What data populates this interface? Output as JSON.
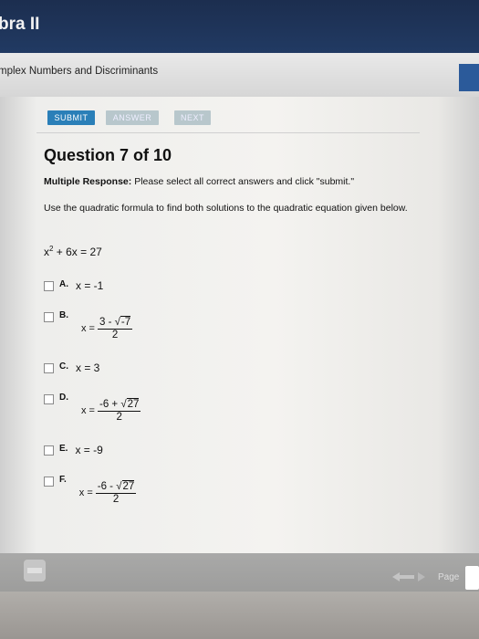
{
  "header": {
    "course_title": "bra II",
    "lesson_title": "mplex Numbers and Discriminants"
  },
  "toolbar": {
    "submit_label": "SUBMIT",
    "answer_label": "ANSWER",
    "next_label": "NEXT"
  },
  "question": {
    "title": "Question 7 of 10",
    "response_type": "Multiple Response:",
    "response_instruction": "Please select all correct answers and click \"submit.\"",
    "instruction": "Use the quadratic formula to find both solutions to the quadratic equation given below.",
    "equation": {
      "base": "x",
      "exponent": "2",
      "rest": " + 6x = 27"
    }
  },
  "options": [
    {
      "letter": "A.",
      "text": "x = -1"
    },
    {
      "letter": "B.",
      "x_eq": "x =",
      "numerator_prefix": "3 - ",
      "root_symbol": "√",
      "radicand": "-7",
      "denominator": "2"
    },
    {
      "letter": "C.",
      "text": "x = 3"
    },
    {
      "letter": "D.",
      "x_eq": "x =",
      "numerator_prefix": "-6 + ",
      "root_symbol": "√",
      "radicand": "27",
      "denominator": "2"
    },
    {
      "letter": "E.",
      "text": "x = -9"
    },
    {
      "letter": "F.",
      "x_eq": "x =",
      "numerator_prefix": "-6 - ",
      "root_symbol": "√",
      "radicand": "27",
      "denominator": "2"
    }
  ],
  "footer": {
    "page_label": "Page",
    "icons": [
      "print-icon",
      "previous-arrow-icon",
      "next-arrow-icon"
    ]
  },
  "colors": {
    "header_bg": "#1c2e4f",
    "submit_bg": "#2a7fb8",
    "disabled_button_bg": "#b8c7cc"
  }
}
